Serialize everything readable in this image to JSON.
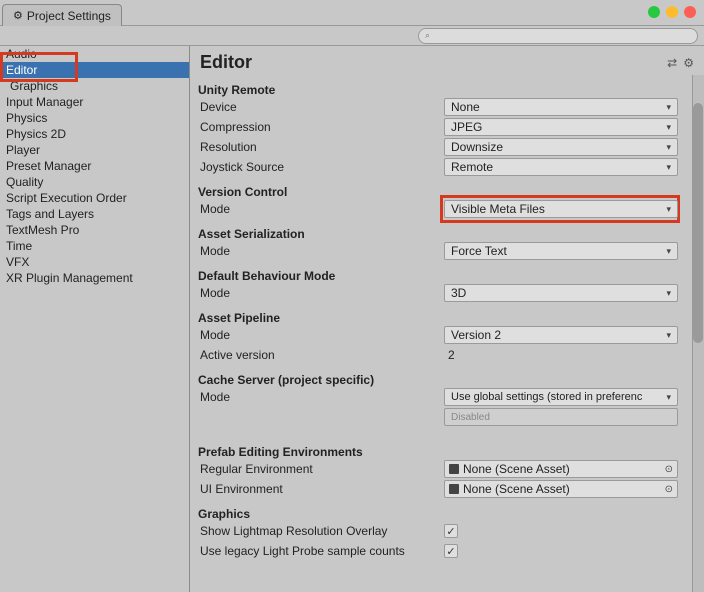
{
  "window": {
    "title": "Project Settings",
    "search_placeholder": ""
  },
  "sidebar": {
    "items": [
      {
        "label": "Audio"
      },
      {
        "label": "Editor",
        "selected": true
      },
      {
        "label": "Graphics"
      },
      {
        "label": "Input Manager"
      },
      {
        "label": "Physics"
      },
      {
        "label": "Physics 2D"
      },
      {
        "label": "Player"
      },
      {
        "label": "Preset Manager"
      },
      {
        "label": "Quality"
      },
      {
        "label": "Script Execution Order"
      },
      {
        "label": "Tags and Layers"
      },
      {
        "label": "TextMesh Pro"
      },
      {
        "label": "Time"
      },
      {
        "label": "VFX"
      },
      {
        "label": "XR Plugin Management"
      }
    ]
  },
  "content": {
    "title": "Editor",
    "sections": {
      "unity_remote": {
        "title": "Unity Remote",
        "device_label": "Device",
        "device_value": "None",
        "compression_label": "Compression",
        "compression_value": "JPEG",
        "resolution_label": "Resolution",
        "resolution_value": "Downsize",
        "joystick_label": "Joystick Source",
        "joystick_value": "Remote"
      },
      "version_control": {
        "title": "Version Control",
        "mode_label": "Mode",
        "mode_value": "Visible Meta Files"
      },
      "asset_serialization": {
        "title": "Asset Serialization",
        "mode_label": "Mode",
        "mode_value": "Force Text"
      },
      "default_behaviour": {
        "title": "Default Behaviour Mode",
        "mode_label": "Mode",
        "mode_value": "3D"
      },
      "asset_pipeline": {
        "title": "Asset Pipeline",
        "mode_label": "Mode",
        "mode_value": "Version 2",
        "active_label": "Active version",
        "active_value": "2"
      },
      "cache_server": {
        "title": "Cache Server (project specific)",
        "mode_label": "Mode",
        "mode_value": "Use global settings (stored in preferenc",
        "disabled_value": "Disabled"
      },
      "prefab": {
        "title": "Prefab Editing Environments",
        "regular_label": "Regular Environment",
        "regular_value": "None (Scene Asset)",
        "ui_label": "UI Environment",
        "ui_value": "None (Scene Asset)"
      },
      "graphics": {
        "title": "Graphics",
        "lightmap_label": "Show Lightmap Resolution Overlay",
        "lightmap_checked": true,
        "legacy_label": "Use legacy Light Probe sample counts",
        "legacy_checked": true
      }
    }
  }
}
